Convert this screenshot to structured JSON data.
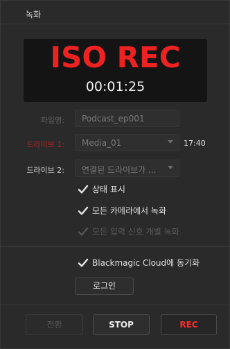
{
  "window": {
    "title": "녹화"
  },
  "display": {
    "mode_text": "ISO REC",
    "timecode": "00:01:25"
  },
  "form": {
    "filename_label": "파일명:",
    "filename_value": "Podcast_ep001",
    "drive1_label": "드라이브 1:",
    "drive1_value": "Media_01",
    "drive1_remaining": "17:40",
    "drive2_label": "드라이브 2:",
    "drive2_value": "연결된 드라이브가 ..."
  },
  "options": {
    "status_display": {
      "label": "상태 표시",
      "checked": true
    },
    "record_all_cameras": {
      "label": "모든 카메라에서 녹화",
      "checked": true
    },
    "record_all_inputs": {
      "label": "모든 입력 신호 개별 녹화",
      "checked": true,
      "enabled": false
    },
    "cloud_sync": {
      "label": "Blackmagic Cloud에 동기화",
      "checked": true
    }
  },
  "buttons": {
    "login": "로그인",
    "cut": "전환",
    "stop": "STOP",
    "rec": "REC"
  },
  "colors": {
    "rec_red": "#ee2222",
    "drive_label_red": "#b32222",
    "panel_bg": "#2a2a2a"
  }
}
